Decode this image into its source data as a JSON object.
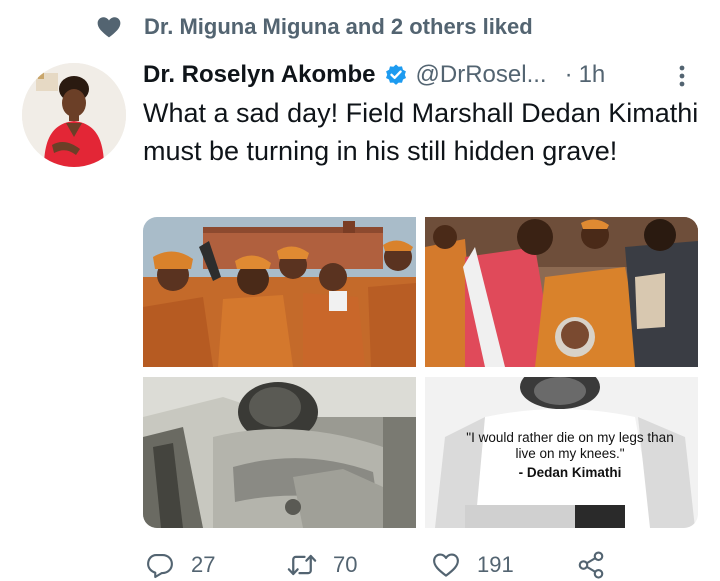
{
  "social_context": {
    "text": "Dr. Miguna Miguna and 2 others liked",
    "icon": "heart-icon"
  },
  "tweet": {
    "author_name": "Dr. Roselyn Akombe",
    "handle": "@DrRosel...",
    "separator": "·",
    "time": "1h",
    "verified": true,
    "text": "What a sad day! Field Marshall Dedan Kimathi must be turning in his still hidden grave!",
    "media": {
      "quote_text": "\"I would rather die on my legs than live on my knees.\"",
      "quote_author": "- Dedan Kimathi"
    }
  },
  "actions": {
    "replies": "27",
    "retweets": "70",
    "likes": "191"
  },
  "colors": {
    "text": "#0f1419",
    "secondary": "#536471",
    "verified": "#1d9bf0",
    "orange_attire": "#d2691e"
  }
}
